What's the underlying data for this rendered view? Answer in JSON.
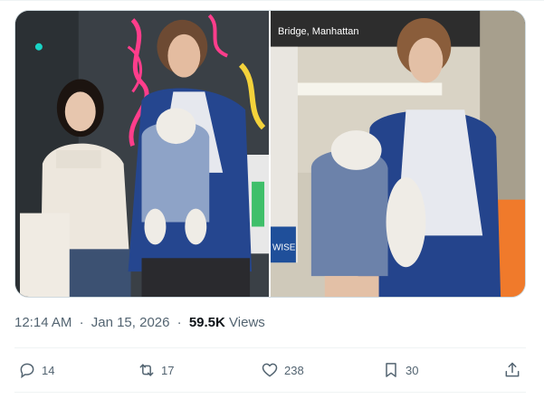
{
  "tweet": {
    "media": [
      {
        "name": "photo-street"
      },
      {
        "name": "photo-subway"
      }
    ],
    "meta": {
      "time": "12:14 AM",
      "separator_1": "·",
      "date": "Jan 15, 2026",
      "separator_2": "·",
      "views_count": "59.5K",
      "views_label": "Views"
    },
    "actions": {
      "reply": {
        "icon": "reply-icon",
        "count": "14"
      },
      "repost": {
        "icon": "repost-icon",
        "count": "17"
      },
      "like": {
        "icon": "heart-icon",
        "count": "238"
      },
      "bookmark": {
        "icon": "bookmark-icon",
        "count": "30"
      },
      "share": {
        "icon": "share-icon"
      }
    }
  },
  "colors": {
    "secondary_text": "#536471",
    "primary_text": "#0f1419",
    "border": "#cfd9de",
    "divider": "#eff3f4"
  },
  "photo_signs": {
    "subway_sign": "Bridge, Manhattan",
    "seat_text": "WISE"
  }
}
